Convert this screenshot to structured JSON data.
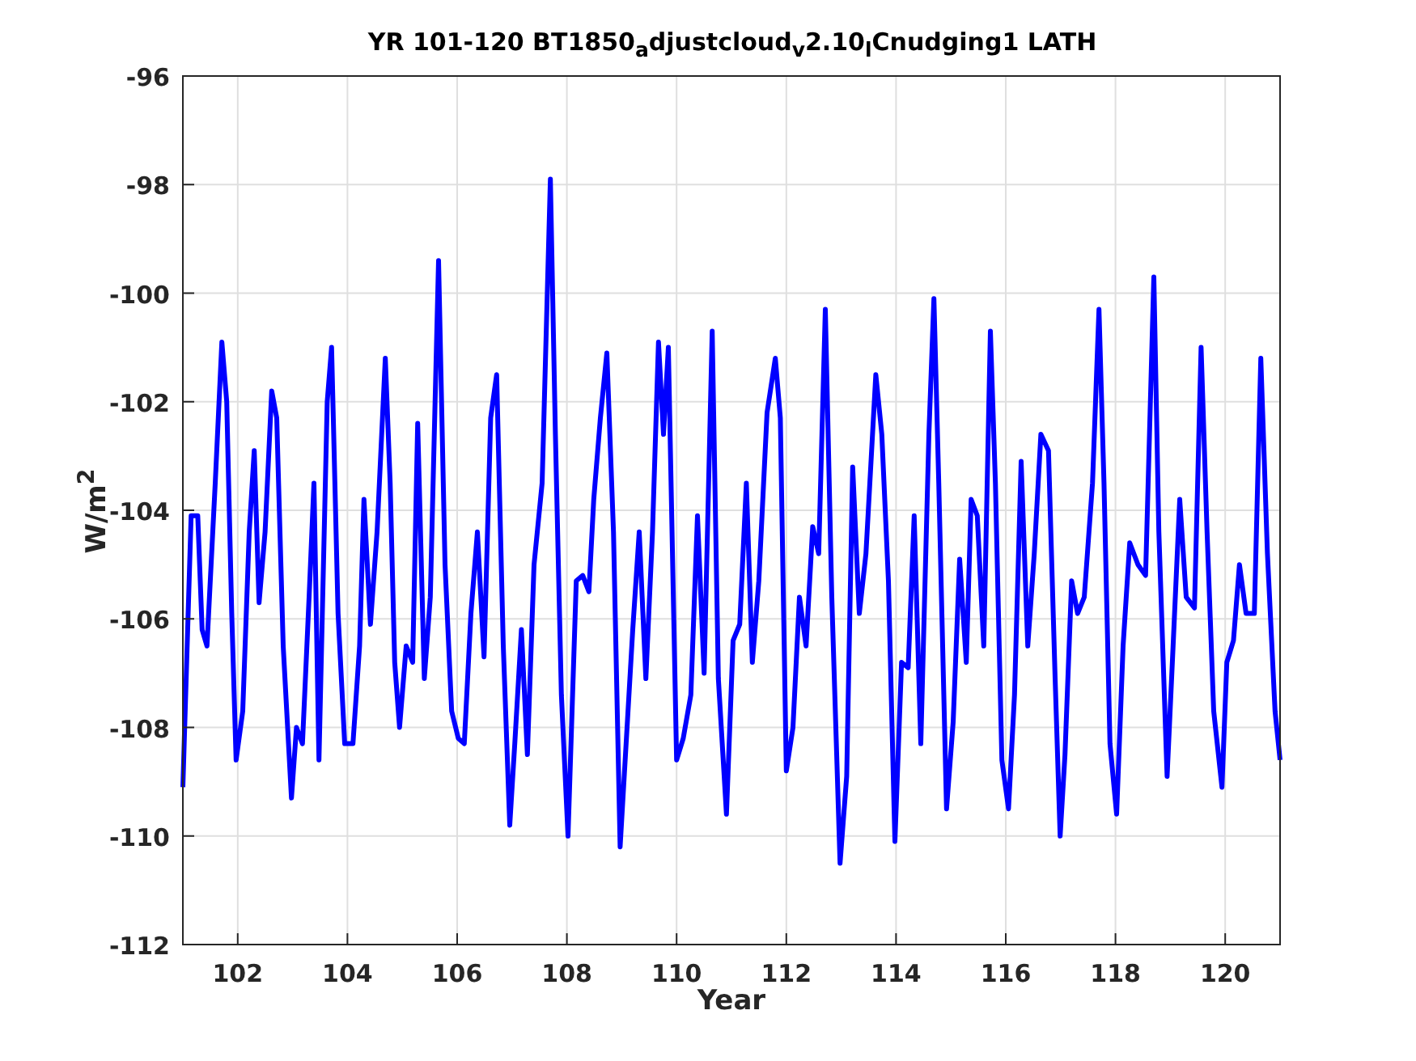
{
  "figure": {
    "title": "YR 101-120 BT1850$_{a}$djustcloud$_{v}$2.10$_{l}$Cnudging1 LATH",
    "ylabel": "W/m$^{2}$",
    "chart_data": {
      "type": "line",
      "grid": true,
      "xlabel": "Year",
      "xlim": [
        101,
        121
      ],
      "ylim": [
        -112,
        -96
      ],
      "xticks": [
        102,
        104,
        106,
        108,
        110,
        112,
        114,
        116,
        118,
        120
      ],
      "yticks": [
        -112,
        -110,
        -108,
        -106,
        -104,
        -102,
        -100,
        -98,
        -96
      ],
      "x": [
        101.0,
        101.15,
        101.27,
        101.35,
        101.44,
        101.59,
        101.71,
        101.8,
        101.89,
        101.97,
        102.09,
        102.21,
        102.3,
        102.39,
        102.5,
        102.62,
        102.71,
        102.83,
        102.98,
        103.07,
        103.18,
        103.3,
        103.39,
        103.48,
        103.63,
        103.71,
        103.83,
        103.95,
        104.1,
        104.22,
        104.3,
        104.42,
        104.54,
        104.69,
        104.78,
        104.86,
        104.95,
        105.07,
        105.19,
        105.28,
        105.4,
        105.51,
        105.66,
        105.78,
        105.9,
        106.02,
        106.13,
        106.25,
        106.37,
        106.49,
        106.61,
        106.72,
        106.84,
        106.96,
        107.05,
        107.17,
        107.28,
        107.4,
        107.55,
        107.7,
        107.79,
        107.9,
        108.02,
        108.17,
        108.29,
        108.4,
        108.49,
        108.61,
        108.73,
        108.85,
        108.97,
        109.08,
        109.2,
        109.32,
        109.44,
        109.56,
        109.67,
        109.76,
        109.85,
        110.0,
        110.12,
        110.26,
        110.38,
        110.5,
        110.65,
        110.76,
        110.91,
        111.03,
        111.15,
        111.27,
        111.38,
        111.5,
        111.65,
        111.8,
        111.89,
        112.0,
        112.12,
        112.24,
        112.36,
        112.48,
        112.59,
        112.71,
        112.83,
        112.98,
        113.1,
        113.21,
        113.33,
        113.45,
        113.63,
        113.74,
        113.86,
        113.98,
        114.1,
        114.22,
        114.33,
        114.45,
        114.6,
        114.69,
        114.78,
        114.92,
        115.04,
        115.16,
        115.28,
        115.37,
        115.48,
        115.6,
        115.72,
        115.81,
        115.93,
        116.05,
        116.16,
        116.28,
        116.4,
        116.52,
        116.64,
        116.78,
        116.9,
        116.99,
        117.08,
        117.2,
        117.31,
        117.43,
        117.58,
        117.7,
        117.79,
        117.9,
        118.02,
        118.14,
        118.26,
        118.41,
        118.55,
        118.7,
        118.79,
        118.94,
        119.05,
        119.17,
        119.29,
        119.44,
        119.56,
        119.67,
        119.79,
        119.94,
        120.03,
        120.15,
        120.26,
        120.38,
        120.53,
        120.65,
        120.77,
        120.91,
        121.0
      ],
      "series": [
        {
          "color": "#0000ff",
          "values": [
            -109.1,
            -104.1,
            -104.1,
            -106.2,
            -106.5,
            -103.5,
            -100.9,
            -102.0,
            -105.9,
            -108.6,
            -107.7,
            -104.4,
            -102.9,
            -105.7,
            -104.4,
            -101.8,
            -102.3,
            -106.5,
            -109.3,
            -108.0,
            -108.3,
            -105.6,
            -103.5,
            -108.6,
            -102.0,
            -101.0,
            -105.9,
            -108.3,
            -108.3,
            -106.5,
            -103.8,
            -106.1,
            -104.4,
            -101.2,
            -103.5,
            -106.8,
            -108.0,
            -106.5,
            -106.8,
            -102.4,
            -107.1,
            -105.6,
            -99.4,
            -105.0,
            -107.7,
            -108.2,
            -108.3,
            -105.9,
            -104.4,
            -106.7,
            -102.3,
            -101.5,
            -106.5,
            -109.8,
            -108.3,
            -106.2,
            -108.5,
            -105.0,
            -103.5,
            -97.9,
            -102.6,
            -107.4,
            -110.0,
            -105.3,
            -105.2,
            -105.5,
            -103.8,
            -102.3,
            -101.1,
            -104.4,
            -110.2,
            -108.3,
            -106.2,
            -104.4,
            -107.1,
            -104.4,
            -100.9,
            -102.6,
            -101.0,
            -108.6,
            -108.2,
            -107.4,
            -104.1,
            -107.0,
            -100.7,
            -107.1,
            -109.6,
            -106.4,
            -106.1,
            -103.5,
            -106.8,
            -105.3,
            -102.2,
            -101.2,
            -102.3,
            -108.8,
            -108.0,
            -105.6,
            -106.5,
            -104.3,
            -104.8,
            -100.3,
            -105.6,
            -110.5,
            -108.9,
            -103.2,
            -105.9,
            -104.8,
            -101.5,
            -102.6,
            -105.3,
            -110.1,
            -106.8,
            -106.9,
            -104.1,
            -108.3,
            -102.6,
            -100.1,
            -103.5,
            -109.5,
            -107.9,
            -104.9,
            -106.8,
            -103.8,
            -104.1,
            -106.5,
            -100.7,
            -103.5,
            -108.6,
            -109.5,
            -107.4,
            -103.1,
            -106.5,
            -104.8,
            -102.6,
            -102.9,
            -107.1,
            -110.0,
            -108.5,
            -105.3,
            -105.9,
            -105.6,
            -103.5,
            -100.3,
            -103.5,
            -108.3,
            -109.6,
            -106.5,
            -104.6,
            -105.0,
            -105.2,
            -99.7,
            -104.4,
            -108.9,
            -106.5,
            -103.8,
            -105.6,
            -105.8,
            -101.0,
            -104.4,
            -107.7,
            -109.1,
            -106.8,
            -106.4,
            -105.0,
            -105.9,
            -105.9,
            -101.2,
            -104.8,
            -107.7,
            -108.6
          ]
        }
      ]
    }
  }
}
